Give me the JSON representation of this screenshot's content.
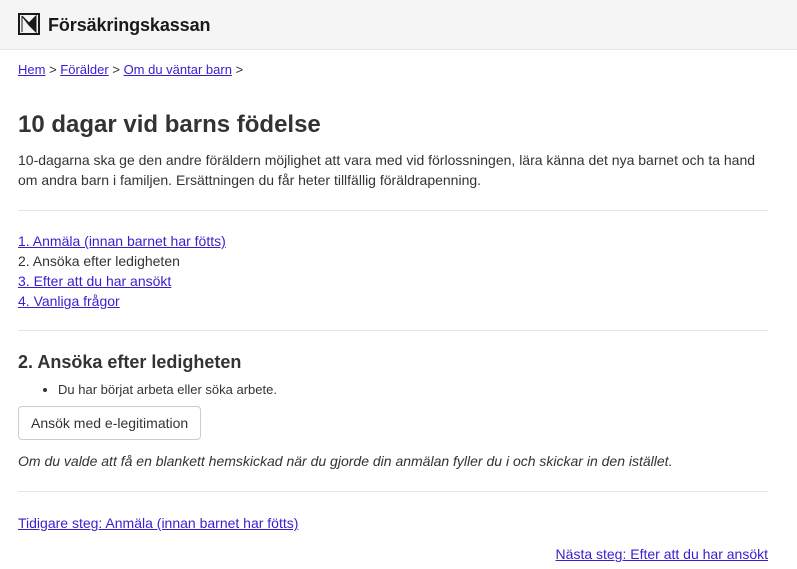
{
  "header": {
    "brand": "Försäkringskassan",
    "logo_icon": "forsakringskassan-logo-icon"
  },
  "breadcrumb": {
    "items": [
      "Hem",
      "Förälder",
      "Om du väntar barn"
    ],
    "separator": ">"
  },
  "page": {
    "title": "10 dagar vid barns födelse",
    "intro": "10-dagarna ska ge den andre föräldern möjlighet att vara med vid förlossningen, lära känna det nya barnet och ta hand om andra barn i familjen. Ersättningen du får heter tillfällig föräldrapenning."
  },
  "steps": [
    {
      "label": "1. Anmäla (innan barnet har fötts)",
      "link": true
    },
    {
      "label": "2. Ansöka efter ledigheten",
      "link": false
    },
    {
      "label": "3. Efter att du har ansökt",
      "link": true
    },
    {
      "label": "4. Vanliga frågor",
      "link": true
    }
  ],
  "section": {
    "heading": "2. Ansöka efter ledigheten",
    "bullets": [
      "Du har börjat arbeta eller söka arbete."
    ],
    "button_label": "Ansök med e-legitimation",
    "note": "Om du valde att få en blankett hemskickad när du gjorde din anmälan fyller du i och skickar in den istället."
  },
  "navigation": {
    "previous": "Tidigare steg: Anmäla (innan barnet har fötts)",
    "next": "Nästa steg: Efter att du har ansökt"
  },
  "colors": {
    "link": "#3d1ccf",
    "text": "#333333",
    "header_bg": "#f5f5f5"
  }
}
